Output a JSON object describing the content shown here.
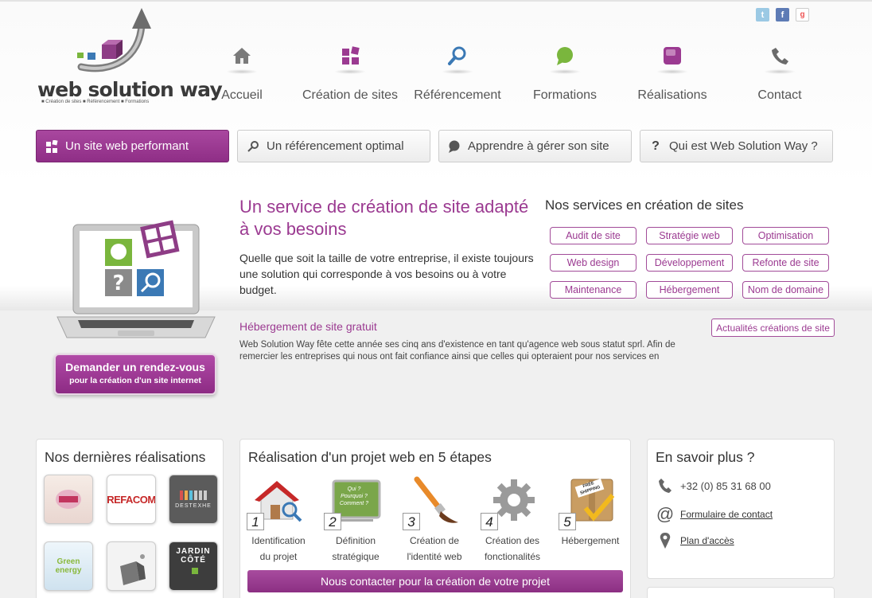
{
  "social": {
    "twitter_icon": "twitter-icon",
    "facebook_icon": "facebook-icon",
    "googleplus_icon": "googleplus-icon"
  },
  "brand": {
    "name": "web solution way",
    "tagline": "■ Création de sites  ■ Référencement  ■ Formations"
  },
  "nav": [
    {
      "label": "Accueil",
      "icon": "home-icon"
    },
    {
      "label": "Création de sites",
      "icon": "squares-icon"
    },
    {
      "label": "Référencement",
      "icon": "magnifier-icon"
    },
    {
      "label": "Formations",
      "icon": "chat-bubble-icon"
    },
    {
      "label": "Réalisations",
      "icon": "cube-icon"
    },
    {
      "label": "Contact",
      "icon": "phone-icon"
    }
  ],
  "tabs": [
    {
      "label": "Un site web performant",
      "active": true
    },
    {
      "label": "Un référencement optimal",
      "active": false
    },
    {
      "label": "Apprendre à gérer son site",
      "active": false
    },
    {
      "label": "Qui est Web Solution Way ?",
      "active": false
    }
  ],
  "hero": {
    "title": "Un service de création de site adapté à vos besoins",
    "text": "Quelle que soit la taille de votre entreprise, il existe toujours une solution qui corresponde à vos besoins ou à votre budget.",
    "rdv_line1": "Demander un rendez-vous",
    "rdv_line2": "pour la création d'un site internet"
  },
  "services": {
    "title": "Nos services en création de sites",
    "items": [
      "Audit de site",
      "Stratégie web",
      "Optimisation",
      "Web design",
      "Développement",
      "Refonte de site",
      "Maintenance",
      "Hébergement",
      "Nom de domaine"
    ]
  },
  "news": {
    "title": "Hébergement de site gratuit",
    "text": "Web Solution Way fête cette année ses cinq ans d'existence en tant qu'agence web sous statut sprl. Afin de remercier les entreprises qui nous ont fait confiance ainsi que celles qui opteraient pour nos services en",
    "button": "Actualités créations de site"
  },
  "realisations": {
    "title": "Nos dernières réalisations",
    "thumbs": [
      "fashion-logo",
      "REFACOM",
      "DESTEXHE",
      "Green energy",
      "paper-box-logo",
      "JARDIN CÔTÉ"
    ]
  },
  "projet": {
    "title": "Réalisation d'un projet web en 5 étapes",
    "steps": [
      {
        "num": "1",
        "label1": "Identification",
        "label2": "du projet"
      },
      {
        "num": "2",
        "label1": "Définition",
        "label2": "stratégique",
        "board": "Qui ? Pourquoi ? Comment ?"
      },
      {
        "num": "3",
        "label1": "Création de",
        "label2": "l'identité web"
      },
      {
        "num": "4",
        "label1": "Création des",
        "label2": "fonctionalités"
      },
      {
        "num": "5",
        "label1": "Hébergement",
        "label2": "",
        "box": "FREE SHIPPING"
      }
    ],
    "cta": "Nous contacter pour la création de votre projet"
  },
  "info": {
    "title": "En savoir plus ?",
    "phone": "+32 (0) 85 31 68 00",
    "contact_form": "Formulaire de contact",
    "map": "Plan d'accès"
  },
  "colors": {
    "accent": "#9b3a91",
    "accent_dark": "#8c2f83"
  }
}
